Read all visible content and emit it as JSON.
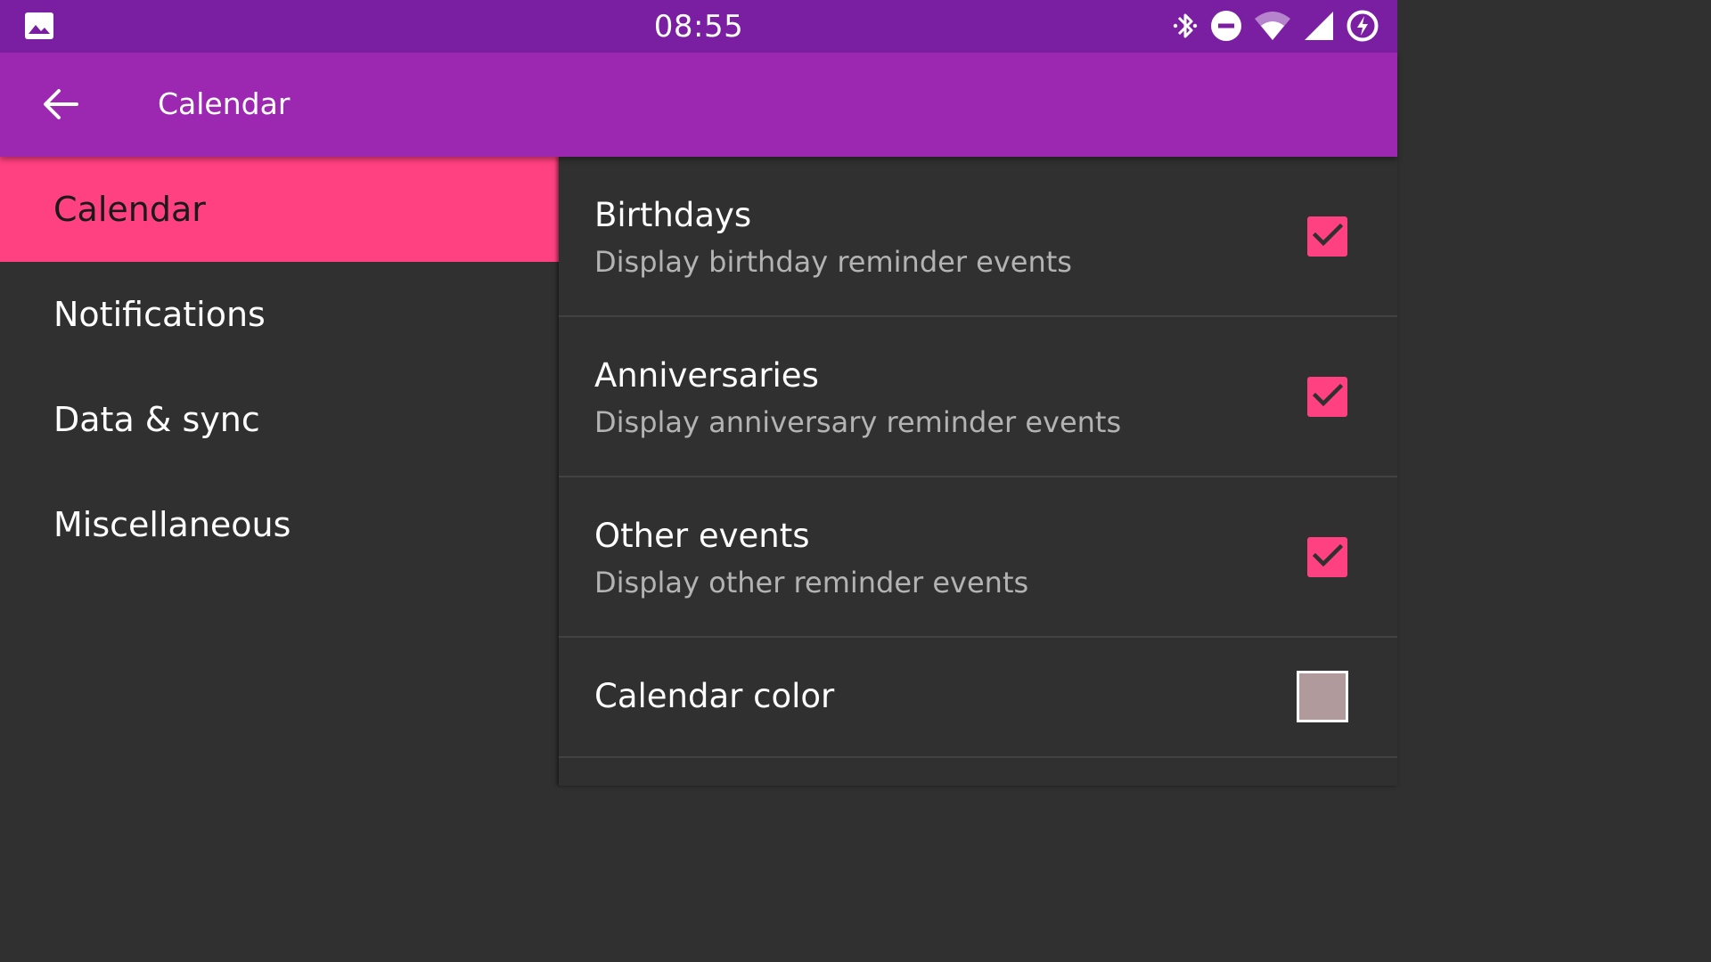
{
  "status_bar": {
    "time": "08:55",
    "icons": [
      "gallery-icon",
      "bluetooth-icon",
      "do-not-disturb-icon",
      "wifi-icon",
      "signal-icon",
      "battery-saver-icon"
    ]
  },
  "toolbar": {
    "title": "Calendar",
    "back_icon": "arrow-back-icon"
  },
  "nav": {
    "items": [
      {
        "label": "Calendar",
        "selected": true
      },
      {
        "label": "Notifications",
        "selected": false
      },
      {
        "label": "Data & sync",
        "selected": false
      },
      {
        "label": "Miscellaneous",
        "selected": false
      }
    ]
  },
  "preferences": [
    {
      "title": "Birthdays",
      "summary": "Display birthday reminder events",
      "checked": true
    },
    {
      "title": "Anniversaries",
      "summary": "Display anniversary reminder events",
      "checked": true
    },
    {
      "title": "Other events",
      "summary": "Display other reminder events",
      "checked": true
    },
    {
      "title": "Calendar color",
      "color": "#b19a9c"
    }
  ],
  "colors": {
    "status_bar": "#7b1fa2",
    "toolbar": "#9c27b0",
    "accent": "#ff4081",
    "background": "#303030"
  }
}
